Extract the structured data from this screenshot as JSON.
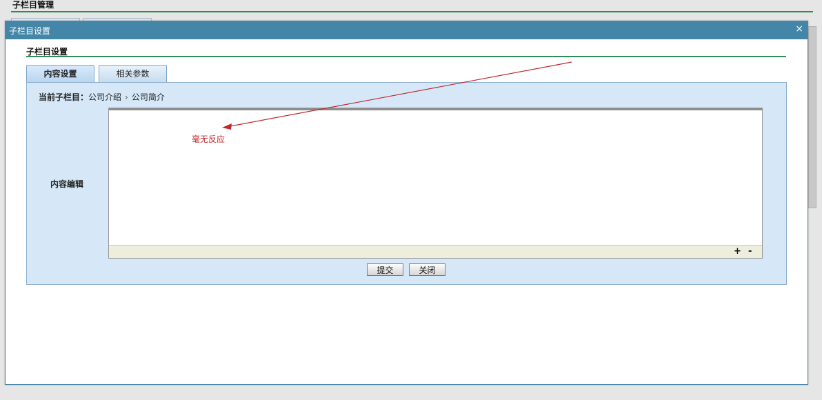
{
  "background": {
    "title": "子栏目管理"
  },
  "dialog": {
    "title": "子栏目设置",
    "close_glyph": "×",
    "section_title": "子栏目设置",
    "tabs": [
      {
        "label": "内容设置",
        "active": true
      },
      {
        "label": "相关参数",
        "active": false
      }
    ],
    "breadcrumb": {
      "label": "当前子栏目：",
      "items": [
        "公司介绍",
        "公司简介"
      ],
      "separator": "›"
    },
    "editor": {
      "label": "内容编辑",
      "content": "",
      "zoom_in": "+",
      "zoom_out": "-"
    },
    "buttons": {
      "submit": "提交",
      "close": "关闭"
    }
  },
  "annotation": {
    "text": "毫无反应",
    "color": "#c0282e"
  },
  "colors": {
    "titlebar": "#4486a7",
    "panel": "#d6e8f8",
    "accent_line": "#2e8b57"
  }
}
